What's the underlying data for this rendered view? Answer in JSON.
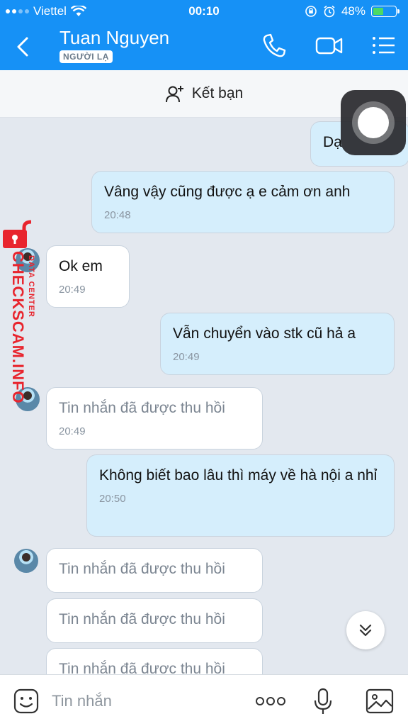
{
  "status_bar": {
    "carrier": "Viettel",
    "time": "00:10",
    "battery": "48%"
  },
  "header": {
    "title": "Tuan Nguyen",
    "badge": "NGƯỜI LẠ"
  },
  "add_friend": {
    "label": "Kết bạn"
  },
  "messages": [
    {
      "text": "Dạ",
      "time": ""
    },
    {
      "text": "Vâng vậy cũng được ạ e cảm ơn anh",
      "time": "20:48"
    },
    {
      "text": "Ok em",
      "time": "20:49"
    },
    {
      "text": "Vẫn chuyển vào stk cũ hả a",
      "time": "20:49"
    },
    {
      "text": "Tin nhắn đã được thu hồi",
      "time": "20:49"
    },
    {
      "text": "Không biết bao lâu thì máy về hà nội a nhỉ",
      "time": "20:50"
    },
    {
      "text": "Tin nhắn đã được thu hồi",
      "time": ""
    },
    {
      "text": "Tin nhắn đã được thu hồi",
      "time": ""
    },
    {
      "text": "Tin nhắn đã được thu hồi",
      "time": ""
    }
  ],
  "watermark": {
    "main": "CHECKSCAM.INFO",
    "sub": "DATA CENTER"
  },
  "composer": {
    "placeholder": "Tin nhắn"
  },
  "colors": {
    "header": "#1691f6",
    "outgoing_bubble": "#d5eefc",
    "incoming_bubble": "#ffffff",
    "watermark": "#e8252e"
  }
}
